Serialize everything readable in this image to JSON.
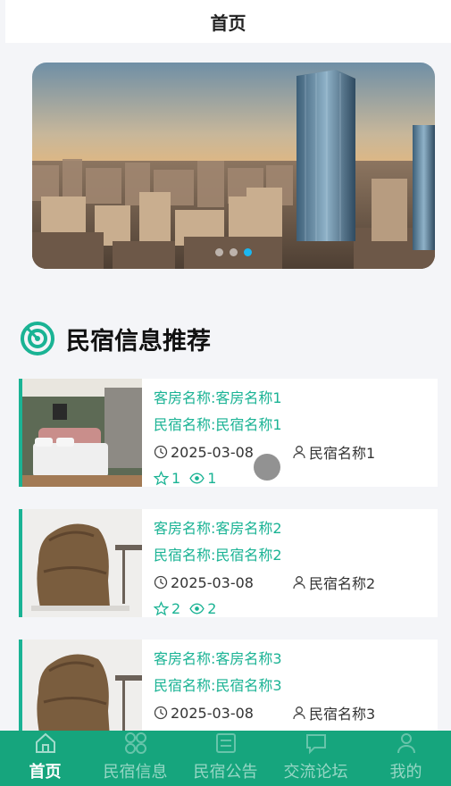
{
  "header": {
    "title": "首页"
  },
  "banner": {
    "slides": 3,
    "active_index": 2
  },
  "section": {
    "title": "民宿信息推荐",
    "icon": "target-icon"
  },
  "listings": [
    {
      "room": "客房名称:客房名称1",
      "homestay": "民宿名称:民宿名称1",
      "date": "2025-03-08",
      "owner": "民宿名称1",
      "likes": "1",
      "views": "1",
      "image": "bedroom"
    },
    {
      "room": "客房名称:客房名称2",
      "homestay": "民宿名称:民宿名称2",
      "date": "2025-03-08",
      "owner": "民宿名称2",
      "likes": "2",
      "views": "2",
      "image": "chair"
    },
    {
      "room": "客房名称:客房名称3",
      "homestay": "民宿名称:民宿名称3",
      "date": "2025-03-08",
      "owner": "民宿名称3",
      "likes": "",
      "views": "",
      "image": "chair"
    }
  ],
  "tabbar": {
    "items": [
      {
        "label": "首页",
        "icon": "home-icon",
        "active": true
      },
      {
        "label": "民宿信息",
        "icon": "grid-icon",
        "active": false
      },
      {
        "label": "民宿公告",
        "icon": "notice-icon",
        "active": false
      },
      {
        "label": "交流论坛",
        "icon": "chat-icon",
        "active": false
      },
      {
        "label": "我的",
        "icon": "user-icon",
        "active": false
      }
    ]
  },
  "colors": {
    "accent": "#1ab394",
    "tabbar": "#16a57d",
    "dot_active": "#1bb7f0"
  }
}
